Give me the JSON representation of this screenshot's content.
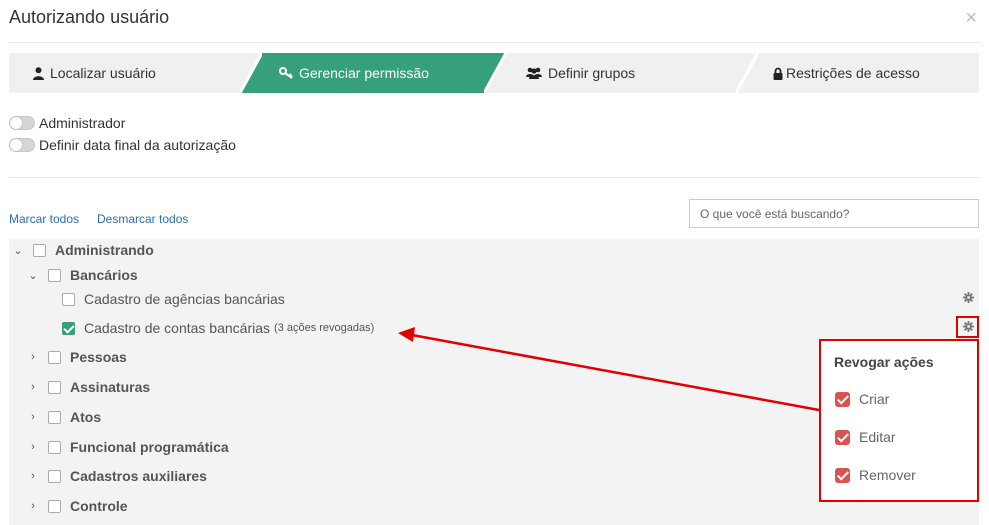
{
  "dialog": {
    "title": "Autorizando usuário",
    "close_glyph": "×"
  },
  "tabs": [
    {
      "label": "Localizar usuário",
      "icon": "user-icon"
    },
    {
      "label": "Gerenciar permissão",
      "icon": "key-icon",
      "active": true
    },
    {
      "label": "Definir grupos",
      "icon": "users-icon"
    },
    {
      "label": "Restrições de acesso",
      "icon": "lock-icon"
    }
  ],
  "toggles": {
    "admin": "Administrador",
    "end_date": "Definir data final da autorização"
  },
  "actions": {
    "select_all": "Marcar todos",
    "deselect_all": "Desmarcar todos"
  },
  "search": {
    "placeholder": "O que você está buscando?"
  },
  "tree": {
    "root": "Administrando",
    "bancarios": "Bancários",
    "agencias": "Cadastro de agências bancárias",
    "contas": "Cadastro de contas bancárias",
    "contas_note": "(3 ações revogadas)",
    "pessoas": "Pessoas",
    "assinaturas": "Assinaturas",
    "atos": "Atos",
    "funcional": "Funcional programática",
    "auxiliares": "Cadastros auxiliares",
    "controle": "Controle"
  },
  "popup": {
    "title": "Revogar ações",
    "options": [
      "Criar",
      "Editar",
      "Remover"
    ]
  },
  "colors": {
    "accent": "#35a07a",
    "highlight": "#e00000",
    "revoke_check": "#d9534f",
    "link": "#2a6fb0"
  }
}
